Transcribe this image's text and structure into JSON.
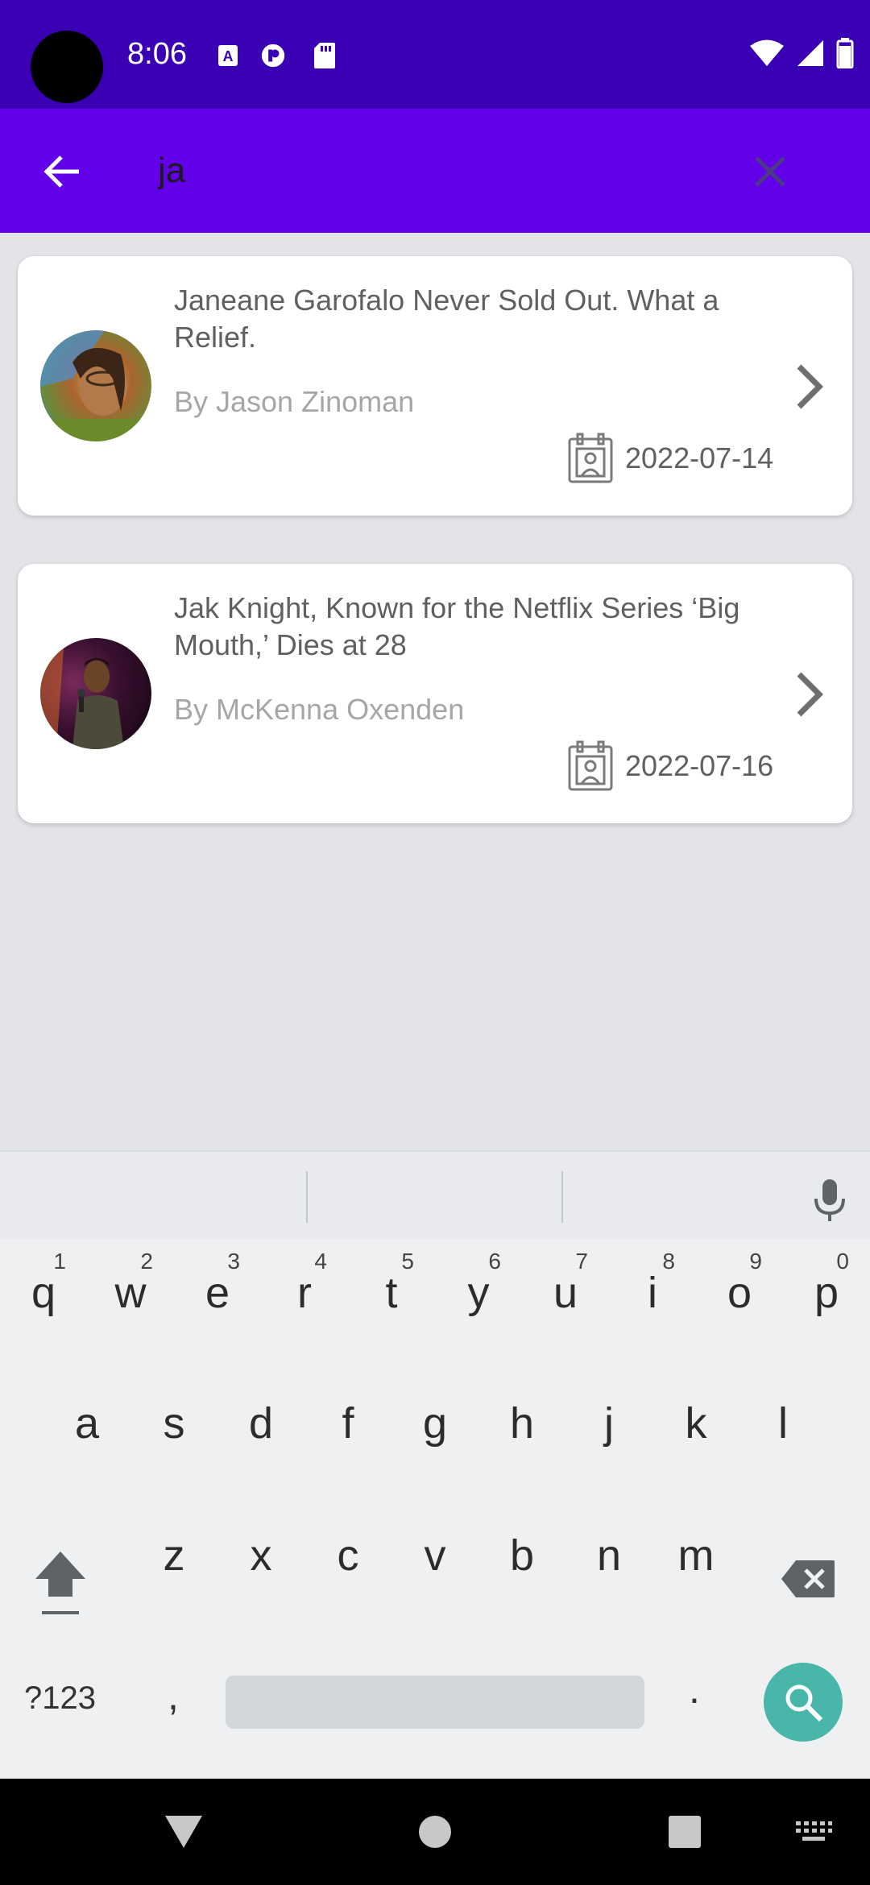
{
  "status_bar": {
    "time": "8:06",
    "icons": [
      "a-icon",
      "circle-p-icon",
      "sd-card-icon",
      "wifi-icon",
      "signal-icon",
      "battery-icon"
    ]
  },
  "app_bar": {
    "search_query": "ja",
    "back_icon": "arrow-back-icon",
    "clear_icon": "close-icon"
  },
  "results": [
    {
      "title": "Janeane Garofalo Never Sold Out. What a Relief.",
      "author": "By Jason Zinoman",
      "date": "2022-07-14"
    },
    {
      "title": "Jak Knight, Known for the Netflix Series ‘Big Mouth,’ Dies at 28",
      "author": "By McKenna Oxenden",
      "date": "2022-07-16"
    }
  ],
  "keyboard": {
    "row1": [
      "q",
      "w",
      "e",
      "r",
      "t",
      "y",
      "u",
      "i",
      "o",
      "p"
    ],
    "row1_nums": [
      "1",
      "2",
      "3",
      "4",
      "5",
      "6",
      "7",
      "8",
      "9",
      "0"
    ],
    "row2": [
      "a",
      "s",
      "d",
      "f",
      "g",
      "h",
      "j",
      "k",
      "l"
    ],
    "row3": [
      "z",
      "x",
      "c",
      "v",
      "b",
      "n",
      "m"
    ],
    "symbols_label": "?123",
    "comma": ",",
    "period": "."
  },
  "colors": {
    "status_bar": "#3a00b3",
    "app_bar": "#6200ea",
    "search_key": "#48b6a8"
  }
}
